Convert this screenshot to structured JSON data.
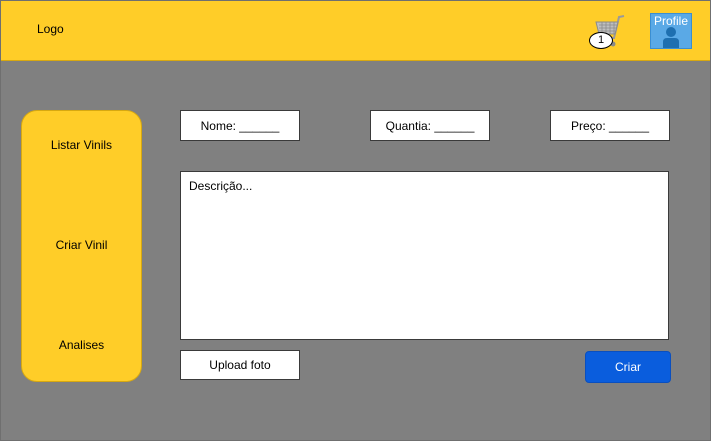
{
  "header": {
    "logo": "Logo",
    "cart": {
      "icon": "shopping-cart-icon",
      "count": "1"
    },
    "profile": {
      "label": "Profile",
      "icon": "user-icon"
    }
  },
  "sidebar": {
    "items": [
      {
        "label": "Listar Vinils"
      },
      {
        "label": "Criar Vinil"
      },
      {
        "label": "Analises"
      }
    ]
  },
  "form": {
    "nome": "Nome: ______",
    "quantia": "Quantia: ______",
    "preco": "Preço: ______",
    "descricao": "Descrição...",
    "upload": "Upload foto",
    "submit": "Criar"
  },
  "colors": {
    "header": "#ffcd28",
    "sidebar": "#ffcd28",
    "background": "#808080",
    "button": "#0a5ddd"
  }
}
